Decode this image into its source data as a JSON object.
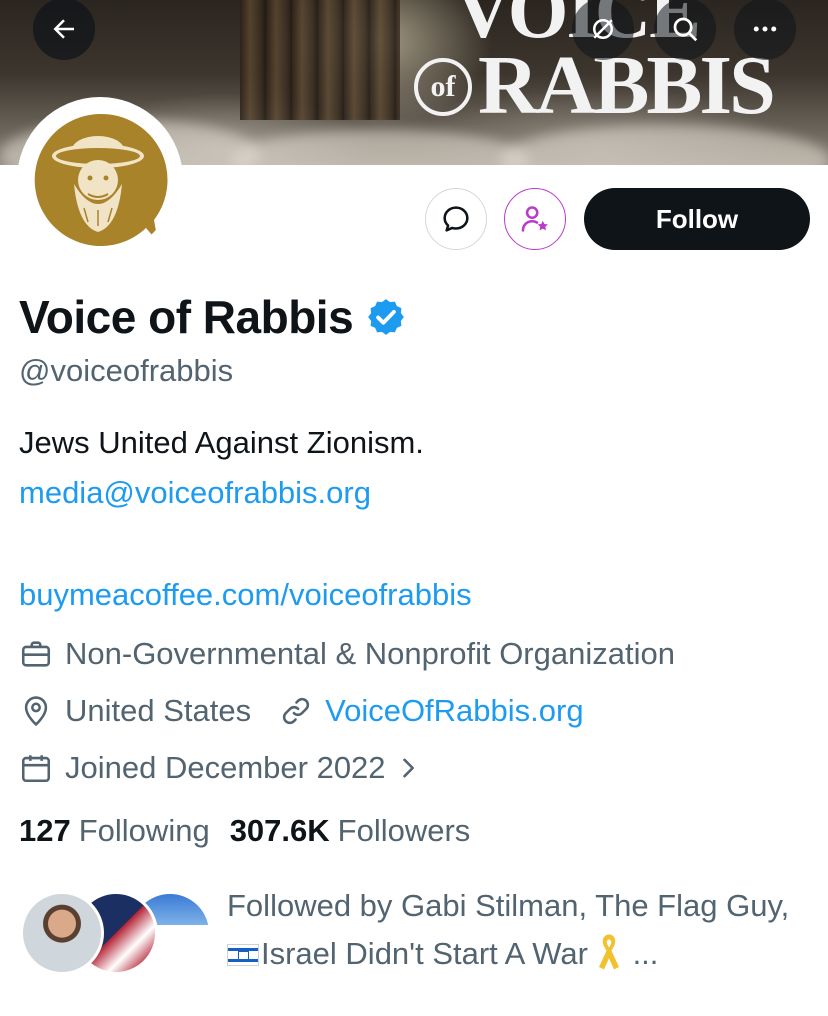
{
  "header": {
    "brand_top": "VOICE",
    "brand_of": "of",
    "brand_main": "RABBIS"
  },
  "actions": {
    "follow_label": "Follow"
  },
  "profile": {
    "display_name": "Voice of Rabbis",
    "handle": "@voiceofrabbis",
    "bio": "Jews United Against Zionism.",
    "email": "media@voiceofrabbis.org",
    "link_in_bio": "buymeacoffee.com/voiceofrabbis",
    "category": "Non-Governmental & Nonprofit Organization",
    "location": "United States",
    "website": "VoiceOfRabbis.org",
    "joined": "Joined December 2022"
  },
  "stats": {
    "following_count": "127",
    "following_label": "Following",
    "followers_count": "307.6K",
    "followers_label": "Followers"
  },
  "followed_by": {
    "prefix": "Followed by Gabi Stilman, The Flag Guy, ",
    "third_name": "Israel Didn't Start A War",
    "suffix": " ..."
  },
  "colors": {
    "accent_blue": "#1d9bf0",
    "secondary_text": "#536471",
    "primary_text": "#0f1419",
    "avatar_gold": "#a9832a",
    "subscribe_purple": "#b93bc9"
  },
  "icons": {
    "back": "arrow-left-icon",
    "grok": "grok-icon",
    "search": "search-icon",
    "more": "more-horizontal-icon",
    "message": "message-bubble-icon",
    "subscribe": "subscribe-person-star-icon",
    "verified": "verified-badge-icon",
    "category": "briefcase-icon",
    "location": "location-pin-icon",
    "link": "link-icon",
    "calendar": "calendar-icon",
    "chevron": "chevron-right-icon",
    "ribbon": "yellow-ribbon-icon"
  }
}
